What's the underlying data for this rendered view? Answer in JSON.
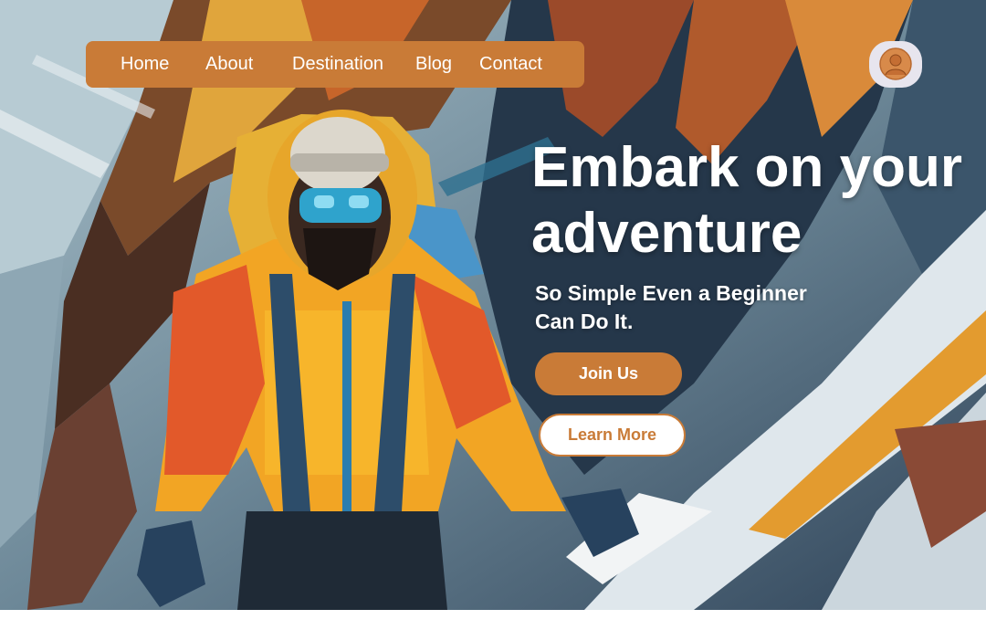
{
  "nav": {
    "items": [
      {
        "label": "Home"
      },
      {
        "label": "About"
      },
      {
        "label": "Destination"
      },
      {
        "label": "Blog"
      },
      {
        "label": "Contact"
      }
    ]
  },
  "profile": {
    "icon": "user-avatar-icon"
  },
  "hero": {
    "headline": "Embark on your adventure",
    "subheadline": "So Simple Even a Beginner Can Do It.",
    "primary_button": "Join Us",
    "secondary_button": "Learn More",
    "background": "painted-mountaineer-illustration"
  },
  "colors": {
    "accent": "#c97b37",
    "nav_text": "#ffffff",
    "headline": "#ffffff",
    "secondary_button_bg": "#ffffff",
    "profile_bg": "#e7e5ee"
  }
}
